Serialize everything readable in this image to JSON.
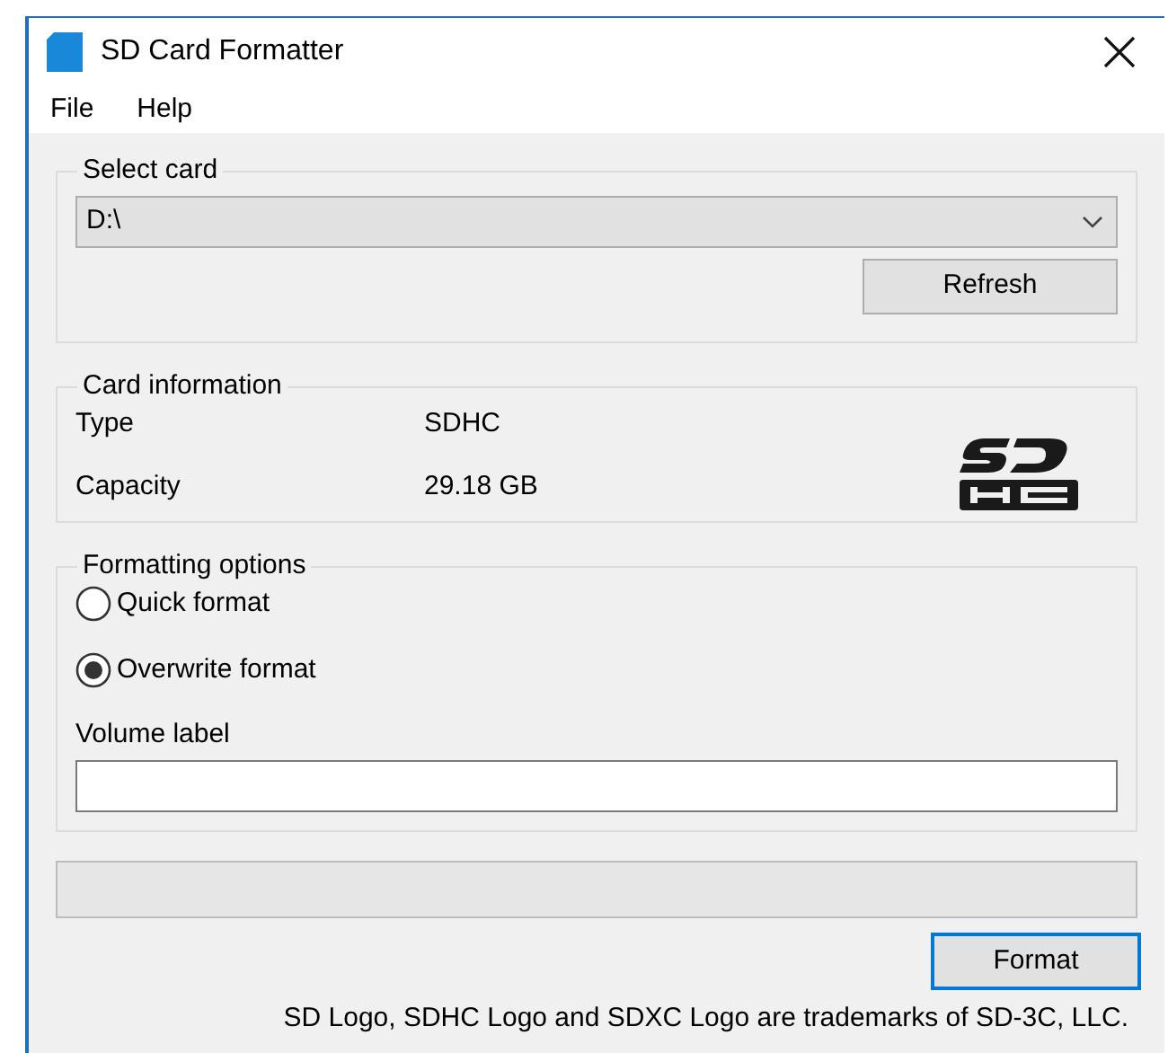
{
  "window": {
    "title": "SD Card Formatter"
  },
  "menu": [
    "File",
    "Help"
  ],
  "select_card": {
    "legend": "Select card",
    "drive": "D:\\",
    "refresh": "Refresh"
  },
  "card_information": {
    "legend": "Card information",
    "rows": [
      {
        "label": "Type",
        "value": "SDHC"
      },
      {
        "label": "Capacity",
        "value": "29.18 GB"
      }
    ]
  },
  "formatting_options": {
    "legend": "Formatting options",
    "options": [
      {
        "label": "Quick format",
        "selected": false
      },
      {
        "label": "Overwrite format",
        "selected": true
      }
    ],
    "volume_label": "Volume label"
  },
  "progress": {
    "level": 0
  },
  "format_button": "Format",
  "footer": "SD Logo, SDHC Logo and SDXC Logo are trademarks of SD-3C, LLC."
}
